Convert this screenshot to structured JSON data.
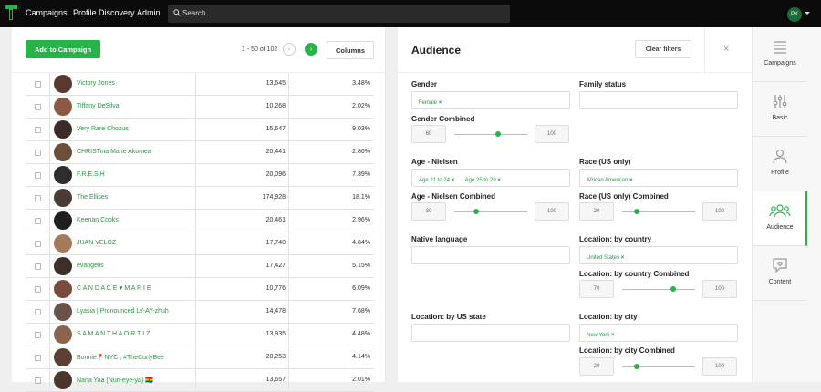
{
  "topbar": {
    "nav": [
      "Campaigns",
      "Profile Discovery",
      "Admin"
    ],
    "search_placeholder": "Search",
    "user_initials": "PK"
  },
  "list": {
    "add_button": "Add to Campaign",
    "pagination": "1 - 50 of 102",
    "columns_button": "Columns",
    "rows": [
      {
        "name": "Victory Jones",
        "followers": "13,645",
        "rate": "3.48%"
      },
      {
        "name": "Tiffany DeSilva",
        "followers": "10,268",
        "rate": "2.02%"
      },
      {
        "name": "Very Rare Chozus",
        "followers": "15,647",
        "rate": "9.03%"
      },
      {
        "name": "CHRISTina Marie Akomea",
        "followers": "20,441",
        "rate": "2.86%"
      },
      {
        "name": "F.R.E.S.H",
        "followers": "20,096",
        "rate": "7.39%"
      },
      {
        "name": "The Ellises",
        "followers": "174,928",
        "rate": "18.1%"
      },
      {
        "name": "Keenan Cooks",
        "followers": "20,461",
        "rate": "2.96%"
      },
      {
        "name": "JUAN VELOZ",
        "followers": "17,740",
        "rate": "4.84%"
      },
      {
        "name": "evangelis",
        "followers": "17,427",
        "rate": "5.15%"
      },
      {
        "name": "C A N D A C E ♥ M A R I E",
        "followers": "10,776",
        "rate": "6.09%"
      },
      {
        "name": "Lyasia | Pronounced LY-AY-zhuh",
        "followers": "14,478",
        "rate": "7.68%"
      },
      {
        "name": "S A M A N T H A O R T I Z",
        "followers": "13,935",
        "rate": "4.48%"
      },
      {
        "name": "Bonnie📍NYC , #TheCurlyBee",
        "followers": "20,253",
        "rate": "4.14%"
      },
      {
        "name": "Nana Yaa (Nun-eye-ya) 🇬🇭",
        "followers": "13,657",
        "rate": "2.01%"
      }
    ]
  },
  "audience": {
    "title": "Audience",
    "clear_filters": "Clear filters",
    "close": "×",
    "gender": {
      "label": "Gender",
      "chips": [
        "Female"
      ]
    },
    "family_status": {
      "label": "Family status"
    },
    "gender_combined": {
      "label": "Gender Combined",
      "min": "60",
      "max": "100",
      "level": 0.6
    },
    "age": {
      "label": "Age - Nielsen",
      "chips": [
        "Age 21 to 24",
        "Age 25 to 29"
      ]
    },
    "race": {
      "label": "Race (US only)",
      "chips": [
        "African American"
      ]
    },
    "age_combined": {
      "label": "Age - Nielsen Combined",
      "min": "30",
      "max": "100",
      "level": 0.3
    },
    "race_combined": {
      "label": "Race (US only) Combined",
      "min": "20",
      "max": "100",
      "level": 0.2
    },
    "native_language": {
      "label": "Native language"
    },
    "country": {
      "label": "Location: by country",
      "chips": [
        "United States"
      ]
    },
    "country_combined": {
      "label": "Location: by country Combined",
      "min": "70",
      "max": "100",
      "level": 0.7
    },
    "us_state": {
      "label": "Location: by US state"
    },
    "city": {
      "label": "Location: by city",
      "chips": [
        "New York"
      ]
    },
    "city_combined": {
      "label": "Location: by city Combined",
      "min": "20",
      "max": "100",
      "level": 0.2
    }
  },
  "sidebar": {
    "items": [
      "Campaigns",
      "Basic",
      "Profile",
      "Audience",
      "Content"
    ],
    "active": "Audience"
  },
  "colors": {
    "accent": "#27b34a",
    "topbar": "#0b0b0b"
  }
}
